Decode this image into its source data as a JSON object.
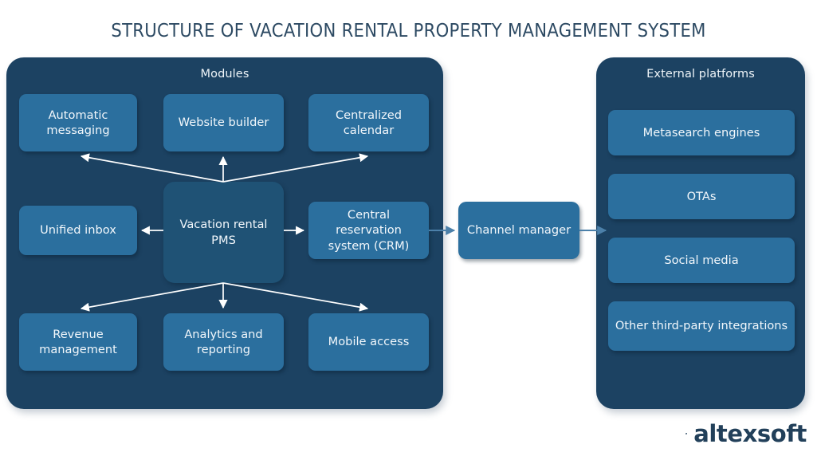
{
  "title": "STRUCTURE OF VACATION RENTAL PROPERTY MANAGEMENT SYSTEM",
  "colors": {
    "background": "#ffffff",
    "title_text": "#2d4a63",
    "panel_fill": "#1c4262",
    "node_fill": "#2b6f9e",
    "core_node_fill": "#1f5275",
    "node_text": "#f2f7fb",
    "white_arrow": "#ffffff",
    "blue_arrow": "#4c80a9",
    "logo_navy": "#22405a"
  },
  "panels": {
    "modules": {
      "title": "Modules",
      "nodes": {
        "automatic_messaging": "Automatic messaging",
        "website_builder": "Website builder",
        "centralized_calendar": "Centralized calendar",
        "unified_inbox": "Unified inbox",
        "pms": "Vacation rental PMS",
        "crm": "Central reservation system (CRM)",
        "revenue_management": "Revenue management",
        "analytics_reporting": "Analytics and reporting",
        "mobile_access": "Mobile access"
      }
    },
    "external": {
      "title": "External platforms",
      "nodes": {
        "metasearch_engines": "Metasearch engines",
        "otas": "OTAs",
        "social_media": "Social media",
        "third_party": "Other third-party integrations"
      }
    }
  },
  "middle": {
    "channel_manager": "Channel manager"
  },
  "connections": [
    {
      "from": "pms",
      "to": "automatic_messaging",
      "style": "white"
    },
    {
      "from": "pms",
      "to": "website_builder",
      "style": "white"
    },
    {
      "from": "pms",
      "to": "centralized_calendar",
      "style": "white"
    },
    {
      "from": "pms",
      "to": "unified_inbox",
      "style": "white"
    },
    {
      "from": "pms",
      "to": "crm",
      "style": "white"
    },
    {
      "from": "pms",
      "to": "revenue_management",
      "style": "white"
    },
    {
      "from": "pms",
      "to": "analytics_reporting",
      "style": "white"
    },
    {
      "from": "pms",
      "to": "mobile_access",
      "style": "white"
    },
    {
      "from": "crm",
      "to": "channel_manager",
      "style": "blue"
    },
    {
      "from": "channel_manager",
      "to": "external_platforms",
      "style": "blue"
    }
  ],
  "branding": {
    "name": "altexsoft",
    "mark": "speech-bubble-icon"
  }
}
